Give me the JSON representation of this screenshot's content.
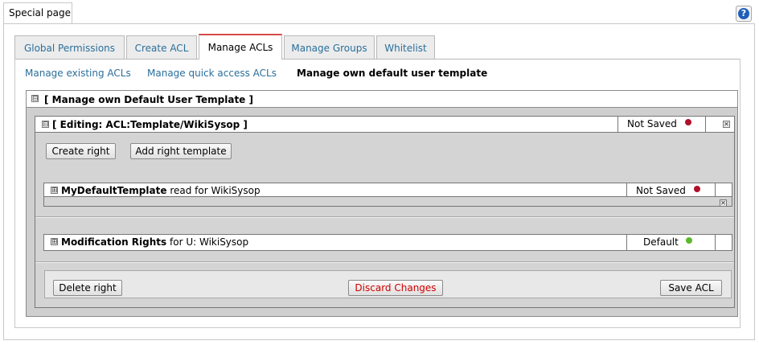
{
  "page": {
    "tab_title": "Special page",
    "help_symbol": "?"
  },
  "tabs": [
    {
      "label": "Global Permissions"
    },
    {
      "label": "Create ACL"
    },
    {
      "label": "Manage ACLs",
      "active": true
    },
    {
      "label": "Manage Groups"
    },
    {
      "label": "Whitelist"
    }
  ],
  "subnav": [
    {
      "label": "Manage existing ACLs"
    },
    {
      "label": "Manage quick access ACLs"
    },
    {
      "label": "Manage own default user template",
      "current": true
    }
  ],
  "outer_panel": {
    "title": "[ Manage own Default User Template ]",
    "toggle": "⊟"
  },
  "editing_panel": {
    "title": "[ Editing: ACL:Template/WikiSysop ]",
    "toggle": "⊟",
    "status": "Not Saved",
    "status_color": "#b0102a",
    "close": "✕",
    "create_right_label": "Create right",
    "add_template_label": "Add right template"
  },
  "rights": [
    {
      "name": "MyDefaultTemplate",
      "detail": "read for WikiSysop",
      "status": "Not Saved",
      "status_color": "#b0102a",
      "toggle": "⊞"
    },
    {
      "name": "Modification Rights",
      "detail": "for U: WikiSysop",
      "status": "Default",
      "status_color": "#5cb82c",
      "toggle": "⊞"
    }
  ],
  "actions": {
    "delete_label": "Delete right",
    "discard_label": "Discard Changes",
    "save_label": "Save ACL"
  }
}
